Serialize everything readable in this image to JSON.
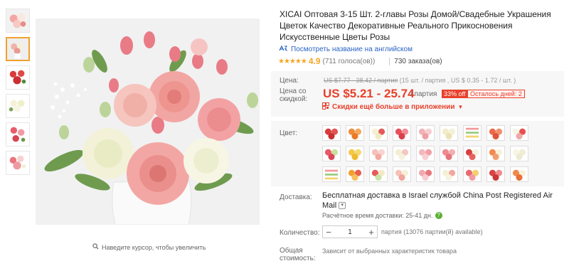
{
  "gallery": {
    "thumbnails": [
      {
        "alt": "thumb-1"
      },
      {
        "alt": "thumb-2"
      },
      {
        "alt": "thumb-3"
      },
      {
        "alt": "thumb-4"
      },
      {
        "alt": "thumb-5"
      },
      {
        "alt": "thumb-6"
      }
    ],
    "zoom_hint": "Наведите курсор, чтобы увеличить"
  },
  "product": {
    "title": "XICAI Оптовая 3-15 Шт. 2-главы Розы Домой/Свадебные Украшения Цветок Качество Декоративные Реального Прикосновения Искусственные Цветы Розы",
    "translate_label": "Посмотреть название на английском",
    "rating_value": "4.9",
    "votes": "(711 голоса(ов))",
    "orders": "730 заказа(ов)"
  },
  "pricing": {
    "price_label": "Цена:",
    "orig_price": "US $7.77 - 38.42 / партия",
    "orig_unit": "(15 шт. / партия , US $ 0.35 - 1.72 / шт. )",
    "sale_label_1": "Цена со",
    "sale_label_2": "скидкой:",
    "sale_price": "US $5.21 - 25.74",
    "sale_unit": "/ партия",
    "discount": "33% off",
    "days_left": "Осталось дней: 2",
    "app_discount": "Скидки ещё больше в приложении"
  },
  "options": {
    "color_label": "Цвет:",
    "delivery_label": "Доставка:",
    "delivery_text": "Бесплатная доставка в Israel службой China Post Registered Air Mail",
    "delivery_time": "Расчётное время доставки: 25-41 дн.",
    "qty_label": "Количество:",
    "qty_value": "1",
    "qty_note": "партия (13076 партии(й) available)",
    "total_label_1": "Общая",
    "total_label_2": "стоимость:",
    "total_note": "Зависит от выбранных характеристик товара"
  },
  "colors": {
    "accent": "#e8402b",
    "star": "#f5a623",
    "link": "#2a63c4"
  }
}
